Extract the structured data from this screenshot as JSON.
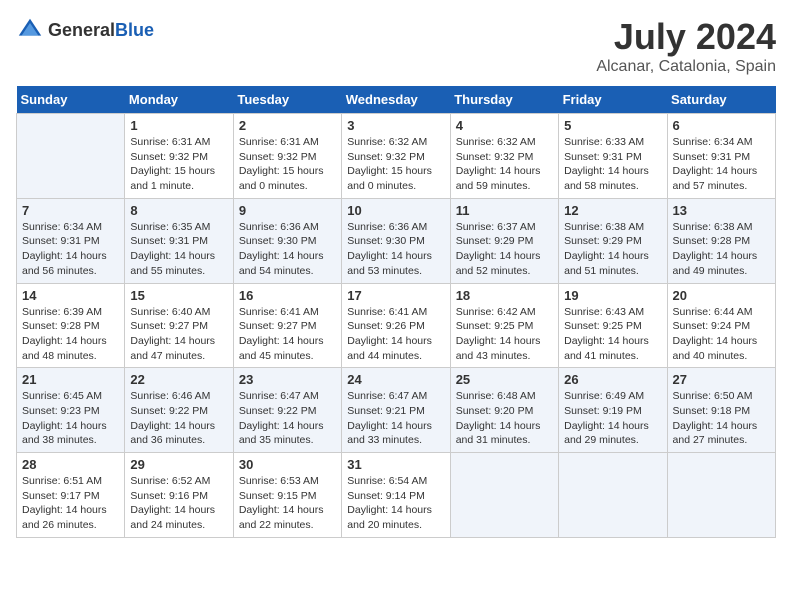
{
  "header": {
    "logo_general": "General",
    "logo_blue": "Blue",
    "month": "July 2024",
    "location": "Alcanar, Catalonia, Spain"
  },
  "days_of_week": [
    "Sunday",
    "Monday",
    "Tuesday",
    "Wednesday",
    "Thursday",
    "Friday",
    "Saturday"
  ],
  "weeks": [
    [
      {
        "day": "",
        "info": ""
      },
      {
        "day": "1",
        "info": "Sunrise: 6:31 AM\nSunset: 9:32 PM\nDaylight: 15 hours\nand 1 minute."
      },
      {
        "day": "2",
        "info": "Sunrise: 6:31 AM\nSunset: 9:32 PM\nDaylight: 15 hours\nand 0 minutes."
      },
      {
        "day": "3",
        "info": "Sunrise: 6:32 AM\nSunset: 9:32 PM\nDaylight: 15 hours\nand 0 minutes."
      },
      {
        "day": "4",
        "info": "Sunrise: 6:32 AM\nSunset: 9:32 PM\nDaylight: 14 hours\nand 59 minutes."
      },
      {
        "day": "5",
        "info": "Sunrise: 6:33 AM\nSunset: 9:31 PM\nDaylight: 14 hours\nand 58 minutes."
      },
      {
        "day": "6",
        "info": "Sunrise: 6:34 AM\nSunset: 9:31 PM\nDaylight: 14 hours\nand 57 minutes."
      }
    ],
    [
      {
        "day": "7",
        "info": "Sunrise: 6:34 AM\nSunset: 9:31 PM\nDaylight: 14 hours\nand 56 minutes."
      },
      {
        "day": "8",
        "info": "Sunrise: 6:35 AM\nSunset: 9:31 PM\nDaylight: 14 hours\nand 55 minutes."
      },
      {
        "day": "9",
        "info": "Sunrise: 6:36 AM\nSunset: 9:30 PM\nDaylight: 14 hours\nand 54 minutes."
      },
      {
        "day": "10",
        "info": "Sunrise: 6:36 AM\nSunset: 9:30 PM\nDaylight: 14 hours\nand 53 minutes."
      },
      {
        "day": "11",
        "info": "Sunrise: 6:37 AM\nSunset: 9:29 PM\nDaylight: 14 hours\nand 52 minutes."
      },
      {
        "day": "12",
        "info": "Sunrise: 6:38 AM\nSunset: 9:29 PM\nDaylight: 14 hours\nand 51 minutes."
      },
      {
        "day": "13",
        "info": "Sunrise: 6:38 AM\nSunset: 9:28 PM\nDaylight: 14 hours\nand 49 minutes."
      }
    ],
    [
      {
        "day": "14",
        "info": "Sunrise: 6:39 AM\nSunset: 9:28 PM\nDaylight: 14 hours\nand 48 minutes."
      },
      {
        "day": "15",
        "info": "Sunrise: 6:40 AM\nSunset: 9:27 PM\nDaylight: 14 hours\nand 47 minutes."
      },
      {
        "day": "16",
        "info": "Sunrise: 6:41 AM\nSunset: 9:27 PM\nDaylight: 14 hours\nand 45 minutes."
      },
      {
        "day": "17",
        "info": "Sunrise: 6:41 AM\nSunset: 9:26 PM\nDaylight: 14 hours\nand 44 minutes."
      },
      {
        "day": "18",
        "info": "Sunrise: 6:42 AM\nSunset: 9:25 PM\nDaylight: 14 hours\nand 43 minutes."
      },
      {
        "day": "19",
        "info": "Sunrise: 6:43 AM\nSunset: 9:25 PM\nDaylight: 14 hours\nand 41 minutes."
      },
      {
        "day": "20",
        "info": "Sunrise: 6:44 AM\nSunset: 9:24 PM\nDaylight: 14 hours\nand 40 minutes."
      }
    ],
    [
      {
        "day": "21",
        "info": "Sunrise: 6:45 AM\nSunset: 9:23 PM\nDaylight: 14 hours\nand 38 minutes."
      },
      {
        "day": "22",
        "info": "Sunrise: 6:46 AM\nSunset: 9:22 PM\nDaylight: 14 hours\nand 36 minutes."
      },
      {
        "day": "23",
        "info": "Sunrise: 6:47 AM\nSunset: 9:22 PM\nDaylight: 14 hours\nand 35 minutes."
      },
      {
        "day": "24",
        "info": "Sunrise: 6:47 AM\nSunset: 9:21 PM\nDaylight: 14 hours\nand 33 minutes."
      },
      {
        "day": "25",
        "info": "Sunrise: 6:48 AM\nSunset: 9:20 PM\nDaylight: 14 hours\nand 31 minutes."
      },
      {
        "day": "26",
        "info": "Sunrise: 6:49 AM\nSunset: 9:19 PM\nDaylight: 14 hours\nand 29 minutes."
      },
      {
        "day": "27",
        "info": "Sunrise: 6:50 AM\nSunset: 9:18 PM\nDaylight: 14 hours\nand 27 minutes."
      }
    ],
    [
      {
        "day": "28",
        "info": "Sunrise: 6:51 AM\nSunset: 9:17 PM\nDaylight: 14 hours\nand 26 minutes."
      },
      {
        "day": "29",
        "info": "Sunrise: 6:52 AM\nSunset: 9:16 PM\nDaylight: 14 hours\nand 24 minutes."
      },
      {
        "day": "30",
        "info": "Sunrise: 6:53 AM\nSunset: 9:15 PM\nDaylight: 14 hours\nand 22 minutes."
      },
      {
        "day": "31",
        "info": "Sunrise: 6:54 AM\nSunset: 9:14 PM\nDaylight: 14 hours\nand 20 minutes."
      },
      {
        "day": "",
        "info": ""
      },
      {
        "day": "",
        "info": ""
      },
      {
        "day": "",
        "info": ""
      }
    ]
  ]
}
